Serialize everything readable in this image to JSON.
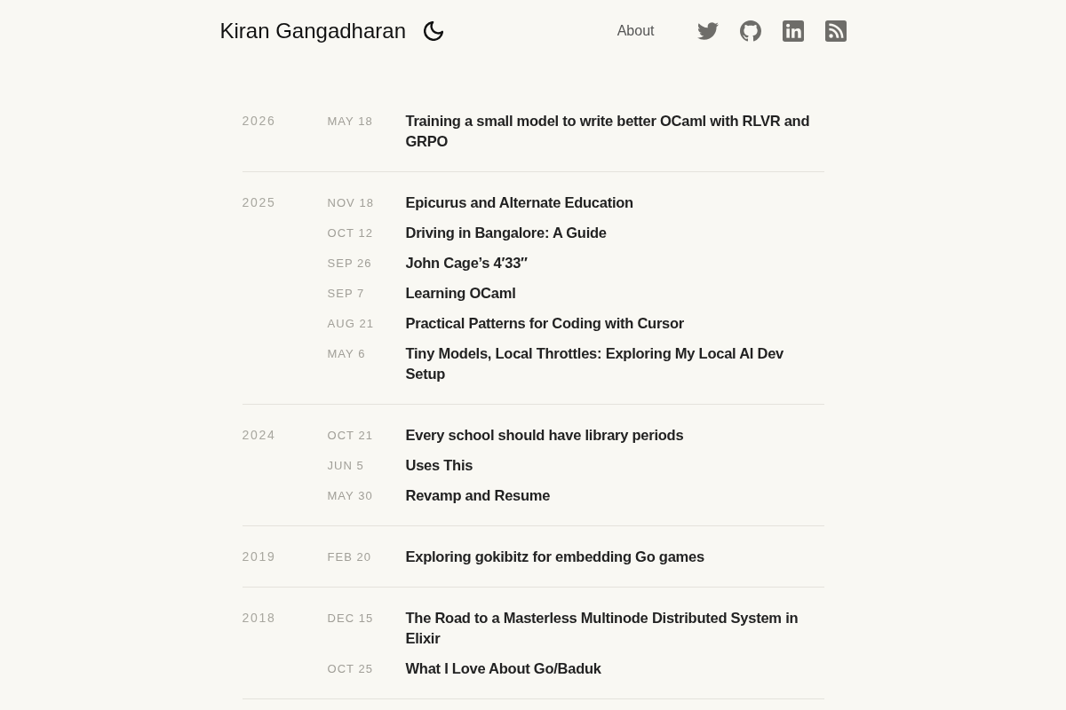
{
  "header": {
    "site_title": "Kiran Gangadharan",
    "nav": [
      {
        "label": "About"
      }
    ],
    "social_links": [
      {
        "kind": "twitter"
      },
      {
        "kind": "github"
      },
      {
        "kind": "linkedin"
      },
      {
        "kind": "rss"
      }
    ]
  },
  "archive": [
    {
      "year": "2026",
      "posts": [
        {
          "date": "MAY 18",
          "title": "Training a small model to write better OCaml with RLVR and GRPO"
        }
      ]
    },
    {
      "year": "2025",
      "posts": [
        {
          "date": "NOV 18",
          "title": "Epicurus and Alternate Education"
        },
        {
          "date": "OCT 12",
          "title": "Driving in Bangalore: A Guide"
        },
        {
          "date": "SEP 26",
          "title": "John Cage’s 4′33″"
        },
        {
          "date": "SEP 7",
          "title": "Learning OCaml"
        },
        {
          "date": "AUG 21",
          "title": "Practical Patterns for Coding with Cursor"
        },
        {
          "date": "MAY 6",
          "title": "Tiny Models, Local Throttles: Exploring My Local AI Dev Setup"
        }
      ]
    },
    {
      "year": "2024",
      "posts": [
        {
          "date": "OCT 21",
          "title": "Every school should have library periods"
        },
        {
          "date": "JUN 5",
          "title": "Uses This"
        },
        {
          "date": "MAY 30",
          "title": "Revamp and Resume"
        }
      ]
    },
    {
      "year": "2019",
      "posts": [
        {
          "date": "FEB 20",
          "title": "Exploring gokibitz for embedding Go games"
        }
      ]
    },
    {
      "year": "2018",
      "posts": [
        {
          "date": "DEC 15",
          "title": "The Road to a Masterless Multinode Distributed System in Elixir"
        },
        {
          "date": "OCT 25",
          "title": "What I Love About Go/Baduk"
        }
      ]
    }
  ]
}
